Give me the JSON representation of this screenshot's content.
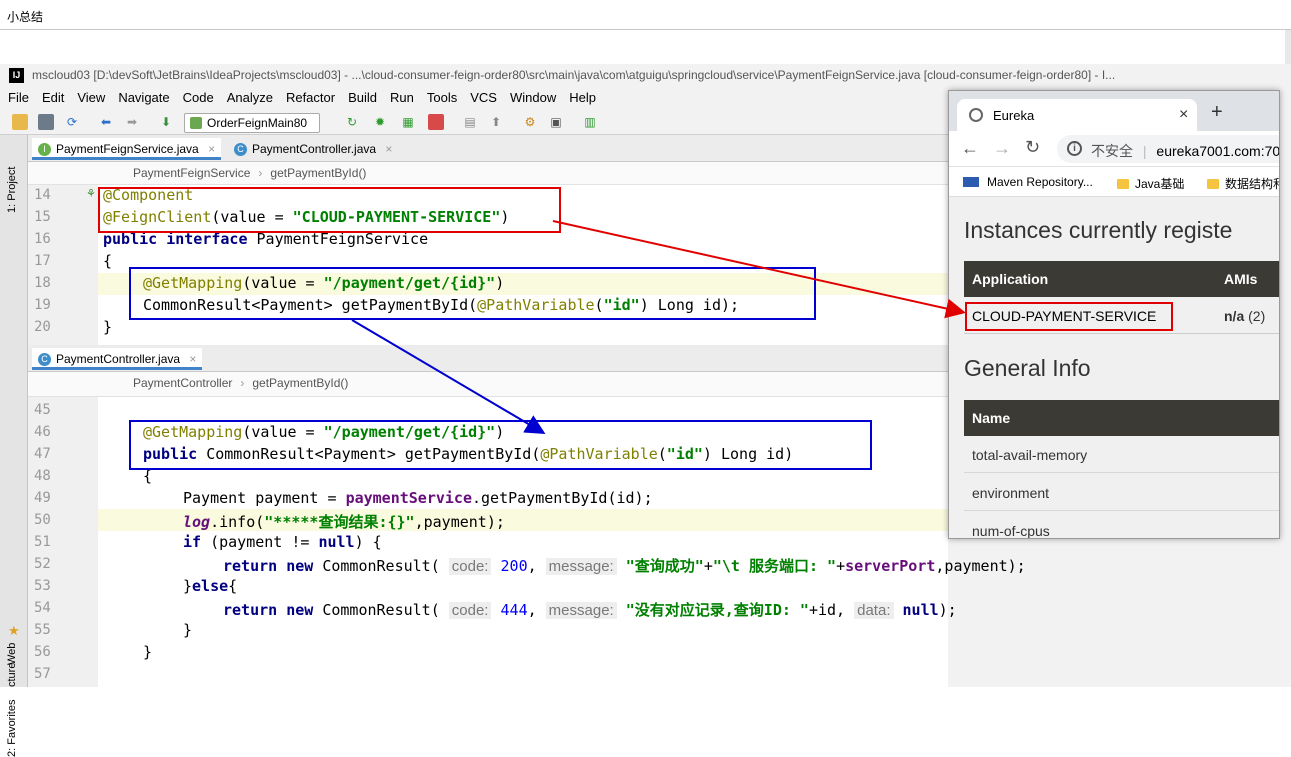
{
  "doc_title": "小总结",
  "ide": {
    "window_title": "mscloud03 [D:\\devSoft\\JetBrains\\IdeaProjects\\mscloud03] - ...\\cloud-consumer-feign-order80\\src\\main\\java\\com\\atguigu\\springcloud\\service\\PaymentFeignService.java [cloud-consumer-feign-order80] - I...",
    "logo_text": "IJ",
    "menu": [
      "File",
      "Edit",
      "View",
      "Navigate",
      "Code",
      "Analyze",
      "Refactor",
      "Build",
      "Run",
      "Tools",
      "VCS",
      "Window",
      "Help"
    ],
    "run_config": "OrderFeignMain80",
    "side_labels": {
      "project": "1: Project",
      "web": "Web",
      "favorites": "2: Favorites",
      "structure": "cture"
    },
    "pane1": {
      "tabs": [
        {
          "label": "PaymentFeignService.java",
          "icon": "interface-icon",
          "active": true
        },
        {
          "label": "PaymentController.java",
          "icon": "class-icon",
          "active": false
        }
      ],
      "breadcrumb": [
        "PaymentFeignService",
        "getPaymentById()"
      ],
      "line_numbers": [
        "14",
        "15",
        "16",
        "17",
        "18",
        "19",
        "20"
      ]
    },
    "pane2": {
      "tabs": [
        {
          "label": "PaymentController.java",
          "icon": "class-icon",
          "active": true
        }
      ],
      "breadcrumb": [
        "PaymentController",
        "getPaymentById()"
      ],
      "line_numbers": [
        "45",
        "46",
        "47",
        "48",
        "49",
        "50",
        "51",
        "52",
        "53",
        "54",
        "55",
        "56",
        "57"
      ]
    },
    "close_glyph": "×"
  },
  "browser": {
    "tab_title": "Eureka",
    "new_tab": "+",
    "security_label": "不安全",
    "url": "eureka7001.com:70",
    "bookmarks": [
      "Maven Repository...",
      "Java基础",
      "数据结构和"
    ],
    "heading_instances": "Instances currently registe",
    "instances_headers": [
      "Application",
      "AMIs"
    ],
    "instance_app": "CLOUD-PAYMENT-SERVICE",
    "instance_amis": "n/a",
    "instance_count": "(2)",
    "heading_general": "General Info",
    "general_header": "Name",
    "general_rows": [
      "total-avail-memory",
      "environment",
      "num-of-cpus"
    ]
  },
  "annotation_colors": {
    "feign_link": "#e00000",
    "mapping_link": "#0000d0"
  }
}
